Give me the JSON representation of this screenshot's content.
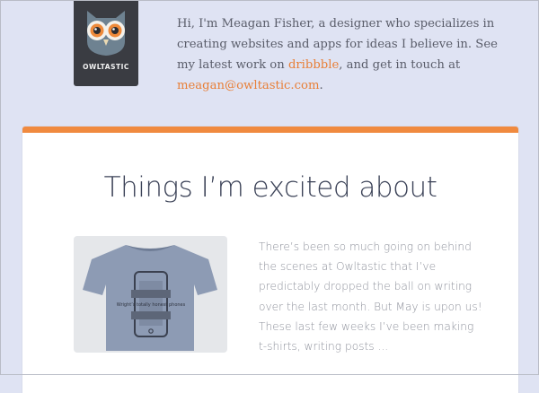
{
  "header": {
    "logo_text": "OWLTASTIC",
    "intro_part1": "Hi, I'm Meagan Fisher, a designer who specializes in creating websites and apps for ideas I believe in. See my latest work on ",
    "dribbble_link": "dribbble",
    "intro_part2": ", and get in touch at ",
    "email_link": "meagan@owltastic.com",
    "intro_part3": "."
  },
  "post": {
    "title": "Things I’m excited about",
    "image_text": "Wright’s totally honest phones",
    "excerpt": "There’s been so much going on behind the scenes at Owltastic that I’ve predictably dropped the ball on writing over the last month. But May is upon us! These last few weeks I’ve been making t-shirts, writing posts ..."
  },
  "colors": {
    "background": "#dfe3f3",
    "accent": "#f08a3f",
    "link": "#e87f37",
    "logo_bg": "#3a3c42",
    "title": "#3b4257"
  }
}
